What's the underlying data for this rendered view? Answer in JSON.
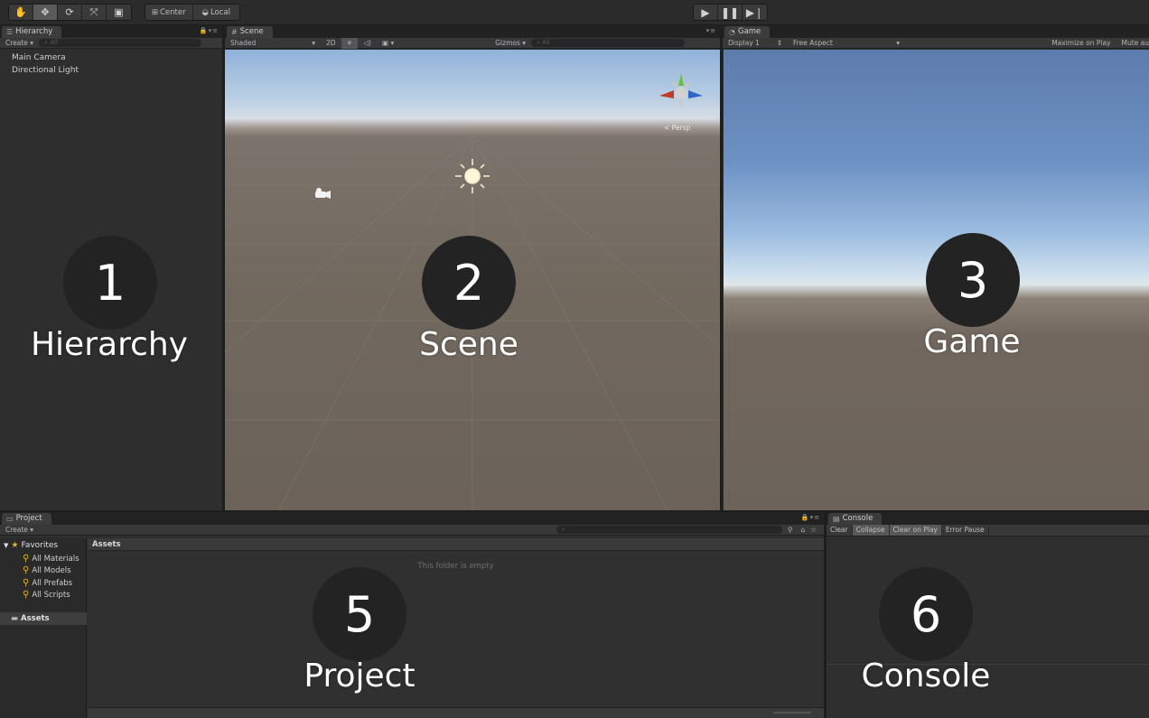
{
  "toolbar": {
    "pivot_center": "Center",
    "pivot_local": "Local"
  },
  "hierarchy": {
    "tab_label": "Hierarchy",
    "create_label": "Create",
    "search_placeholder": "All",
    "items": [
      "Main Camera",
      "Directional Light"
    ]
  },
  "scene": {
    "tab_label": "Scene",
    "shading_mode": "Shaded",
    "mode_2d": "2D",
    "gizmos_label": "Gizmos",
    "search_placeholder": "All",
    "persp_label": "< Persp"
  },
  "game": {
    "tab_label": "Game",
    "display": "Display 1",
    "aspect": "Free Aspect",
    "maximize_label": "Maximize on Play",
    "mute_label": "Mute au"
  },
  "project": {
    "tab_label": "Project",
    "create_label": "Create",
    "favorites_label": "Favorites",
    "favorites": [
      "All Materials",
      "All Models",
      "All Prefabs",
      "All Scripts"
    ],
    "assets_node": "Assets",
    "assets_header": "Assets",
    "empty_message": "This folder is empty"
  },
  "console": {
    "tab_label": "Console",
    "buttons": [
      "Clear",
      "Collapse",
      "Clear on Play",
      "Error Pause"
    ]
  },
  "overlays": [
    {
      "number": "1",
      "label": "Hierarchy"
    },
    {
      "number": "2",
      "label": "Scene"
    },
    {
      "number": "3",
      "label": "Game"
    },
    {
      "number": "5",
      "label": "Project"
    },
    {
      "number": "6",
      "label": "Console"
    }
  ],
  "colors": {
    "editor_bg": "#2e2e2e",
    "favorites_icon": "#e0b526",
    "gizmo_x": "#c0392b",
    "gizmo_y": "#6abf3a",
    "gizmo_z": "#2f64c8"
  }
}
